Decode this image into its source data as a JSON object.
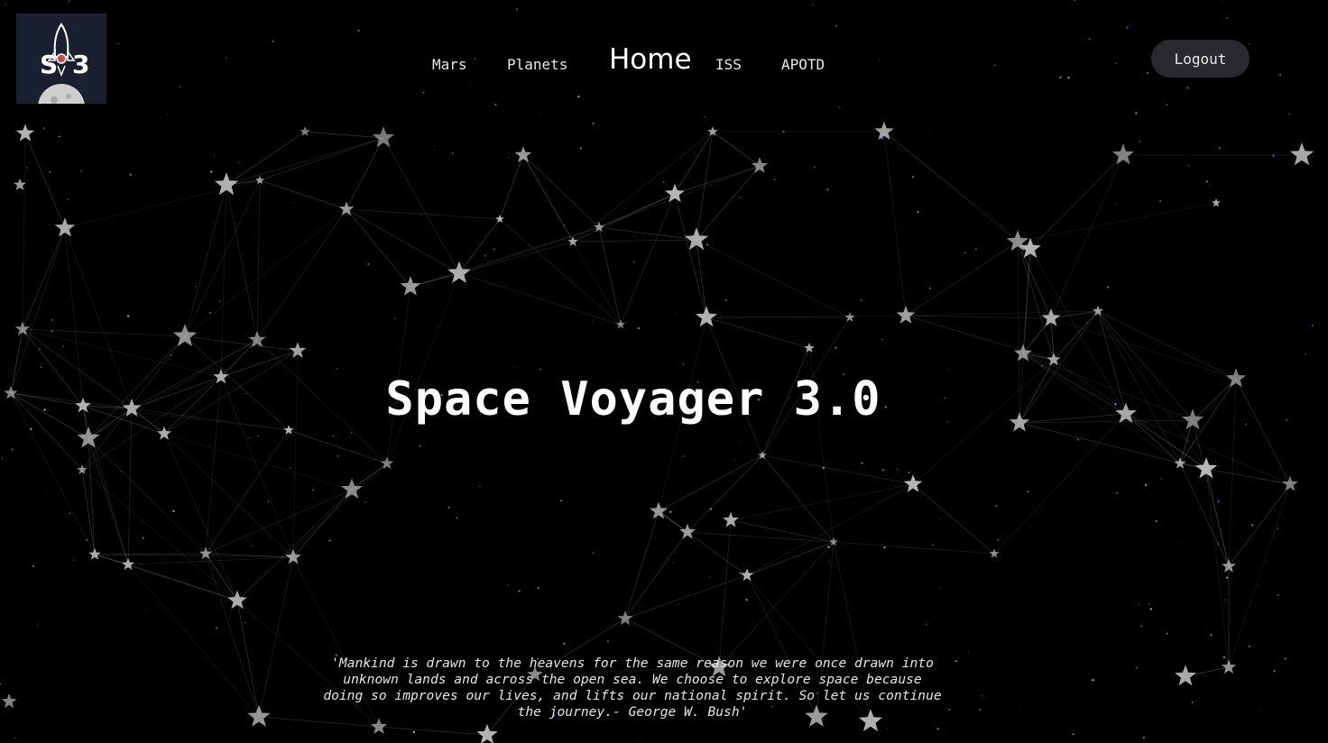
{
  "brand": {
    "logo_text": "S3"
  },
  "nav": {
    "items": [
      {
        "label": "Mars"
      },
      {
        "label": "Planets"
      },
      {
        "label": "Home"
      },
      {
        "label": "ISS"
      },
      {
        "label": "APOTD"
      }
    ],
    "active": "Home"
  },
  "account": {
    "logout_label": "Logout"
  },
  "hero": {
    "title": "Space Voyager 3.0"
  },
  "quote": {
    "text": "'Mankind is drawn to the heavens for the same reason we were once drawn into unknown lands and across the open sea. We choose to explore space because doing so improves our lives, and lifts our national spirit. So let us continue the journey.- George W. Bush'"
  },
  "colors": {
    "background": "#000000",
    "text": "#ffffff",
    "button_bg": "#2a2a2e",
    "constellation_line": "#9a9a9a",
    "star": "#b8b8b8"
  },
  "icons": {
    "logo": "rocket-moon-logo-icon",
    "background": "star-icon"
  }
}
